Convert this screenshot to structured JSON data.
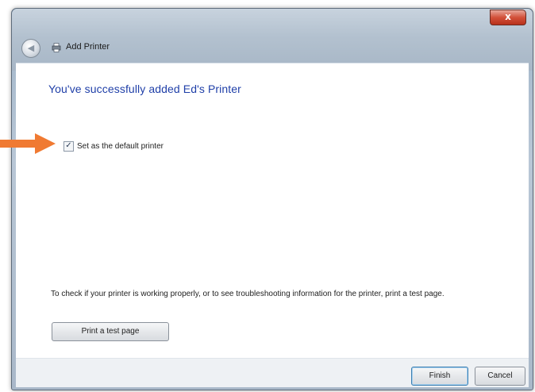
{
  "window": {
    "title": "Add Printer",
    "close_label": "x"
  },
  "main": {
    "heading": "You've successfully added Ed's Printer",
    "default_checkbox": {
      "label": "Set as the default printer",
      "checked": true
    },
    "info_text": "To check if your printer is working properly, or to see troubleshooting information for the printer, print a test page.",
    "print_test_label": "Print a test page"
  },
  "footer": {
    "finish_label": "Finish",
    "cancel_label": "Cancel"
  },
  "colors": {
    "heading": "#1f3fa8",
    "callout_arrow": "#f07a32"
  },
  "icons": [
    "back-arrow-icon",
    "printer-icon",
    "checkmark-icon",
    "pointer-arrow-icon"
  ]
}
